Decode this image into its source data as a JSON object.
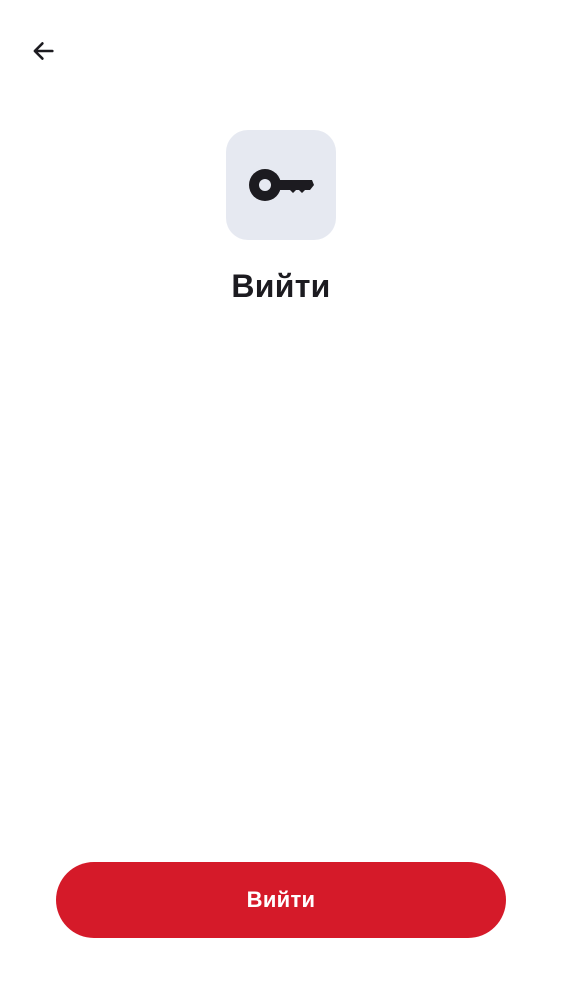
{
  "header": {
    "back_icon": "arrow-left-icon"
  },
  "hero": {
    "icon": "key-icon",
    "icon_tile_color": "#e6e9f1",
    "title": "Вийти"
  },
  "footer": {
    "primary_button_label": "Вийти",
    "primary_button_color": "#d51a29"
  }
}
